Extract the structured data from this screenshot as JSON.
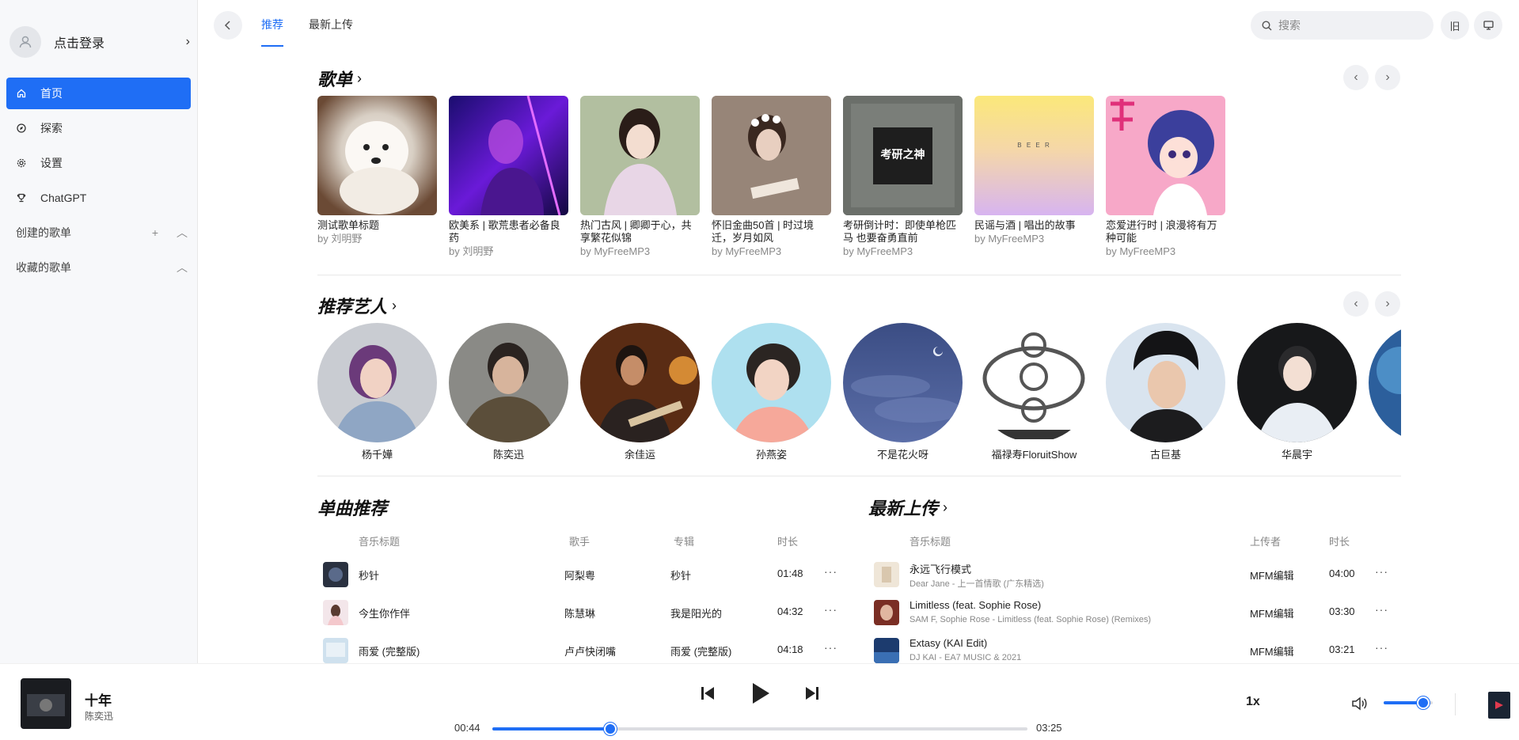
{
  "sidebar": {
    "login_text": "点击登录",
    "nav": [
      {
        "label": "首页",
        "icon": "home-icon"
      },
      {
        "label": "探索",
        "icon": "compass-icon"
      },
      {
        "label": "设置",
        "icon": "gear-icon"
      },
      {
        "label": "ChatGPT",
        "icon": "trophy-icon"
      }
    ],
    "created_playlists": "创建的歌单",
    "collected_playlists": "收藏的歌单"
  },
  "header": {
    "tabs": [
      "推荐",
      "最新上传"
    ],
    "active_tab": 0,
    "search_placeholder": "搜索",
    "old_btn": "旧"
  },
  "playlists": {
    "title": "歌单",
    "items": [
      {
        "title": "测试歌单标题",
        "by": "by 刘明野"
      },
      {
        "title": "欧美系 | 歌荒患者必备良药",
        "by": "by 刘明野"
      },
      {
        "title": "热门古风 | 卿卿于心，共享繁花似锦",
        "by": "by MyFreeMP3"
      },
      {
        "title": "怀旧金曲50首 | 时过境迁，岁月如风",
        "by": "by MyFreeMP3"
      },
      {
        "title": "考研倒计时：即使单枪匹马 也要奋勇直前",
        "by": "by MyFreeMP3"
      },
      {
        "title": "民谣与酒 | 唱出的故事",
        "by": "by MyFreeMP3"
      },
      {
        "title": "恋爱进行时 | 浪漫将有万种可能",
        "by": "by MyFreeMP3"
      }
    ],
    "cover_text_5": "考研之神",
    "cover_text_6": "B E E R"
  },
  "artists": {
    "title": "推荐艺人",
    "items": [
      "杨千嬅",
      "陈奕迅",
      "余佳运",
      "孙燕姿",
      "不是花火呀",
      "福禄寿FloruitShow",
      "古巨基",
      "华晨宇"
    ]
  },
  "singles": {
    "title": "单曲推荐",
    "headers": {
      "title": "音乐标题",
      "artist": "歌手",
      "album": "专辑",
      "duration": "时长"
    },
    "rows": [
      {
        "title": "秒针",
        "artist": "阿梨粤",
        "album": "秒针",
        "duration": "01:48"
      },
      {
        "title": "今生你作伴",
        "artist": "陈慧琳",
        "album": "我是阳光的",
        "duration": "04:32"
      },
      {
        "title": "雨爱 (完整版)",
        "artist": "卢卢快闭嘴",
        "album": "雨爱 (完整版)",
        "duration": "04:18"
      }
    ]
  },
  "latest": {
    "title": "最新上传",
    "headers": {
      "title": "音乐标题",
      "uploader": "上传者",
      "duration": "时长"
    },
    "rows": [
      {
        "title": "永远飞行模式",
        "sub": "Dear Jane - 上一首情歌 (广东精选)",
        "uploader": "MFM编辑",
        "duration": "04:00"
      },
      {
        "title": "Limitless (feat. Sophie Rose)",
        "sub": "SAM F, Sophie Rose - Limitless (feat. Sophie Rose) (Remixes)",
        "uploader": "MFM编辑",
        "duration": "03:30"
      },
      {
        "title": "Extasy (KAI Edit)",
        "sub": "DJ KAI - EA7 MUSIC & 2021",
        "uploader": "MFM编辑",
        "duration": "03:21"
      }
    ]
  },
  "player": {
    "title": "十年",
    "artist": "陈奕迅",
    "current_time": "00:44",
    "total_time": "03:25",
    "progress": 0.22,
    "speed": "1x",
    "volume": 0.8
  },
  "colors": {
    "accent": "#1f6ef5"
  }
}
